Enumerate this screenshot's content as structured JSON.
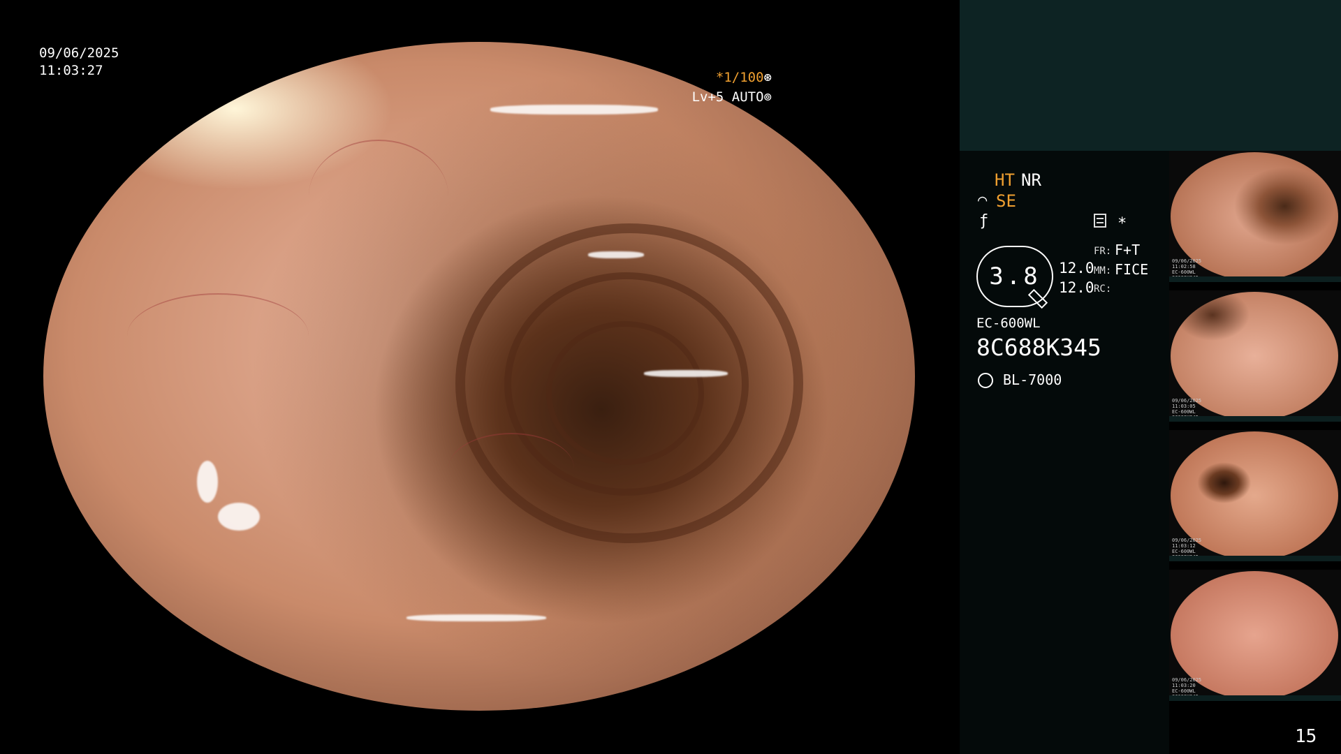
{
  "overlay": {
    "date": "09/06/2025",
    "time": "11:03:27",
    "shutter": "*1/100",
    "shutter_icon": "aperture-icon",
    "level": "Lv+5 AUTO",
    "level_icon": "iris-icon"
  },
  "info": {
    "ht": "HT",
    "nr": "NR",
    "se": "SE",
    "se_icon": "wave-icon",
    "f_icon": "f-icon",
    "menu_icon": "menu-icon",
    "asterisk": "*",
    "zoom": "3.8",
    "val1": "12.0",
    "val2": "12.0",
    "fr_label": "FR:",
    "fr_value": "F+T",
    "mm_label": "MM:",
    "mm_value": "FICE",
    "rc_label": "RC:",
    "scope_model": "EC-600WL",
    "serial": "8C688K345",
    "light_source": "BL-7000",
    "light_icon": "sun-icon"
  },
  "thumbnails": [
    {
      "caption": "09/06/2025\n11:02:58\nEC-600WL\n8C688K345"
    },
    {
      "caption": "09/06/2025\n11:03:05\nEC-600WL\n8C688K345"
    },
    {
      "caption": "09/06/2025\n11:03:12\nEC-600WL\n8C688K345"
    },
    {
      "caption": "09/06/2025\n11:03:20\nEC-600WL\n8C688K345"
    }
  ],
  "frame_number": "15",
  "colors": {
    "accent_orange": "#f0a030",
    "panel_teal": "#0d2323",
    "panel_dark": "#040a0a"
  }
}
